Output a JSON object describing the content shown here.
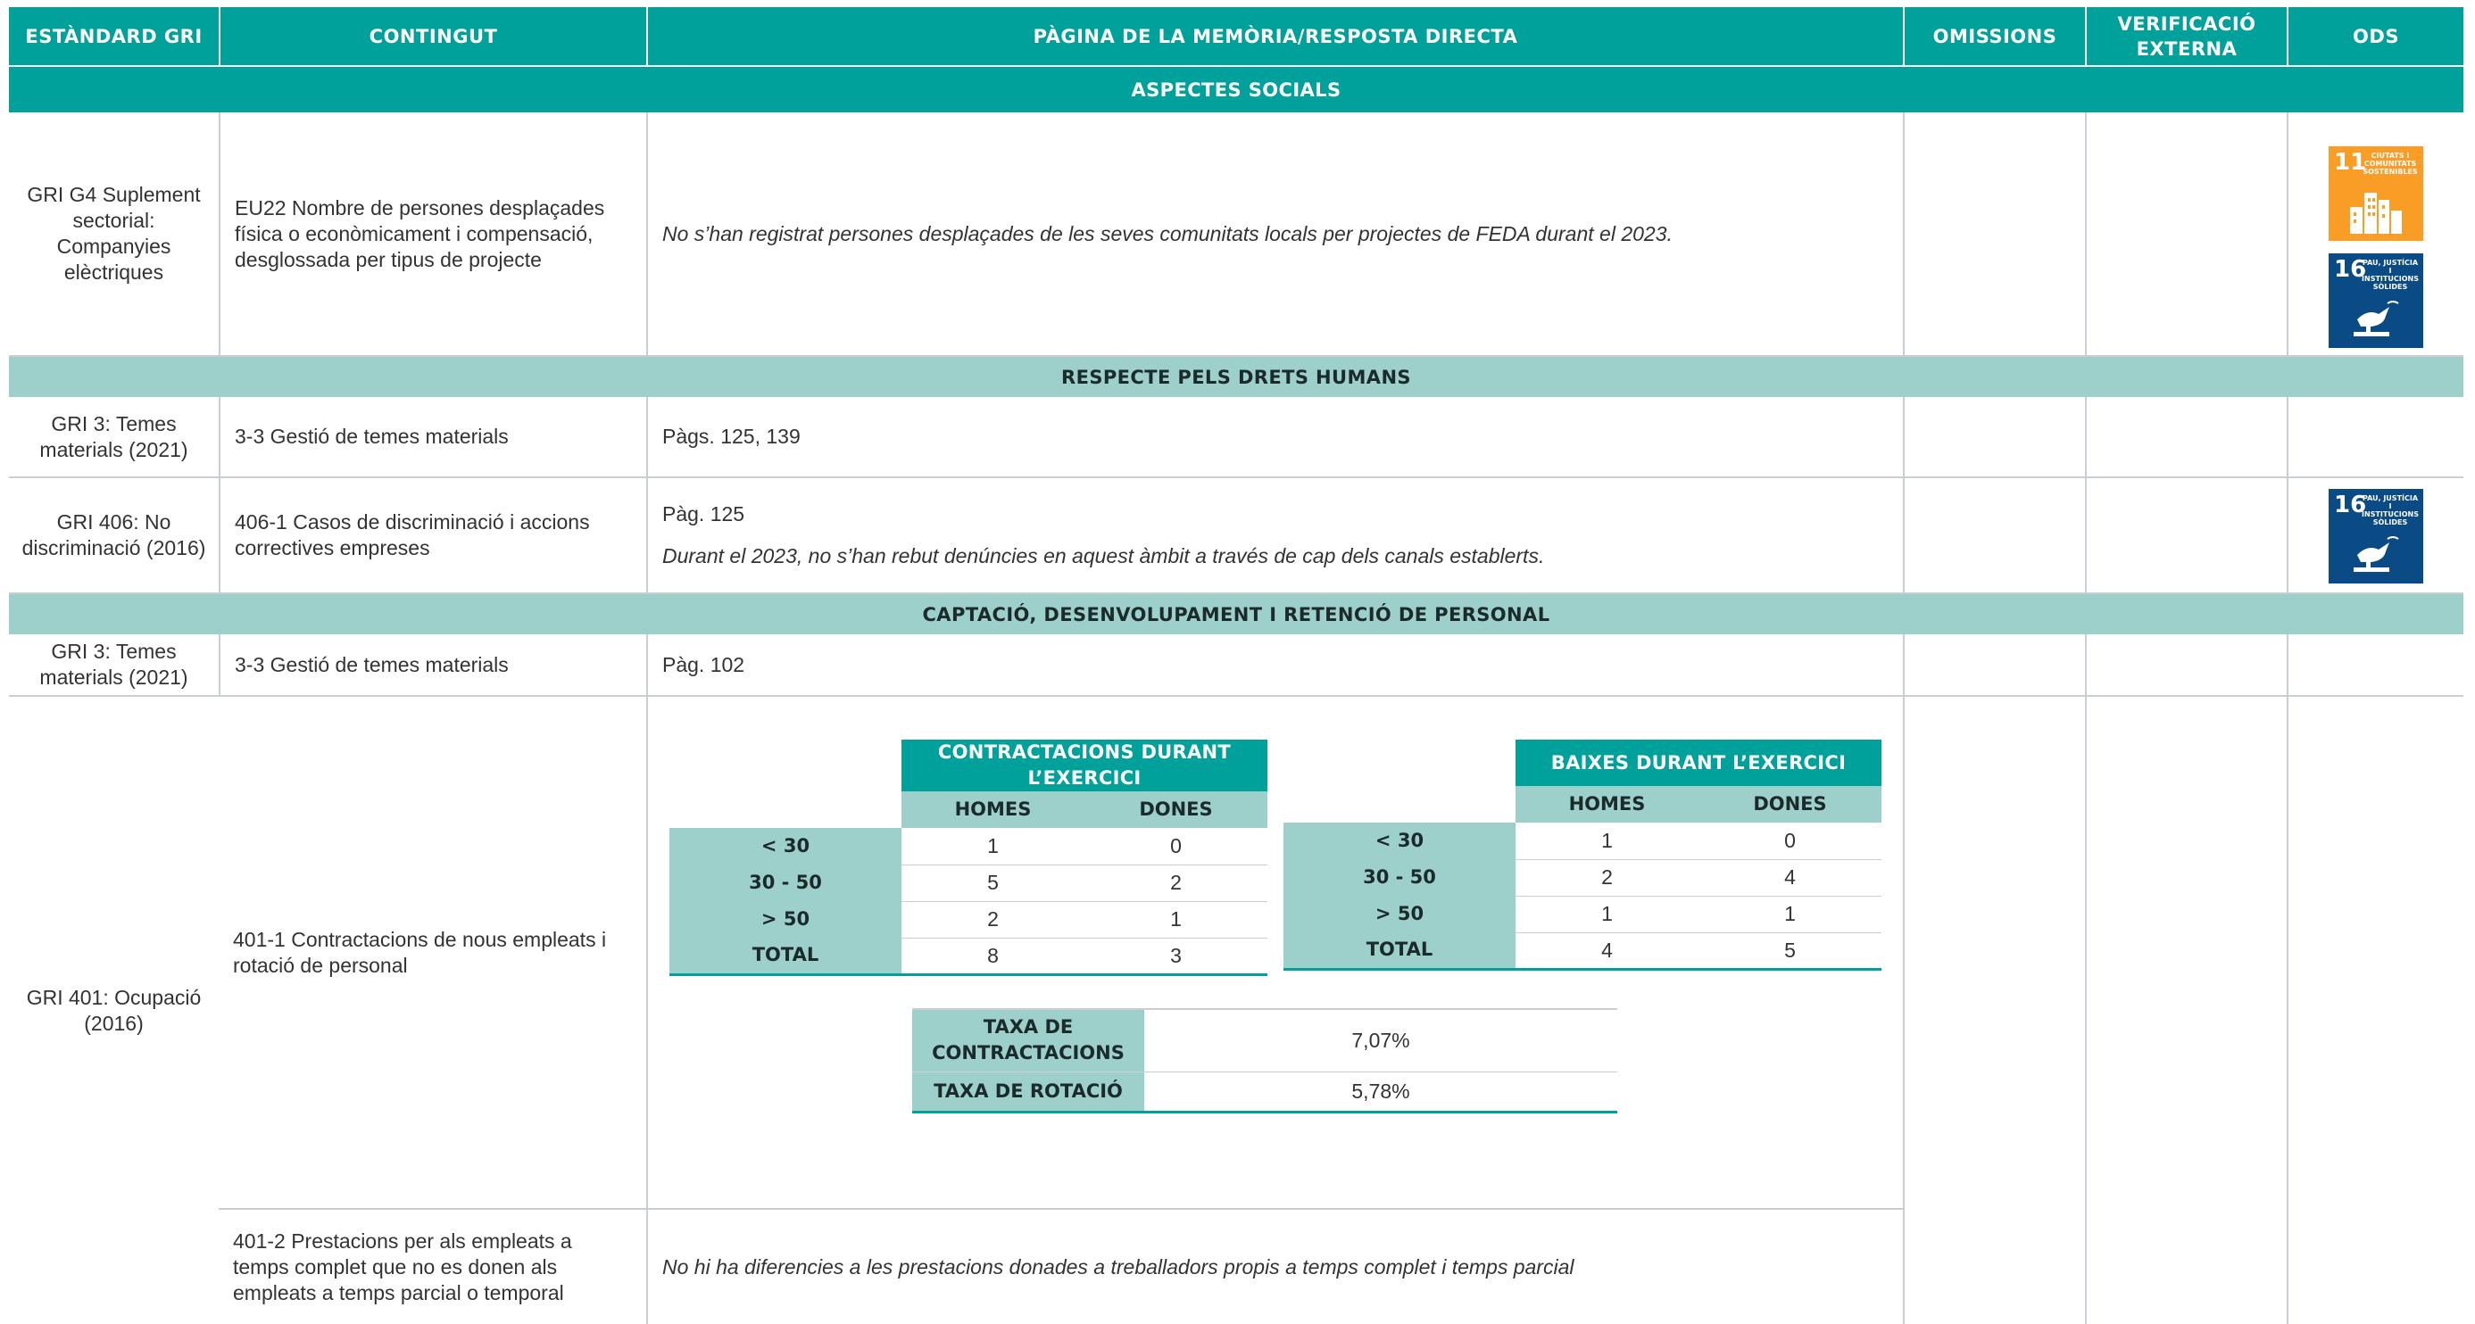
{
  "header": {
    "col1": "ESTÀNDARD GRI",
    "col2": "CONTINGUT",
    "col3": "PÀGINA DE LA MEMÒRIA/RESPOSTA DIRECTA",
    "col4": "OMISSIONS",
    "col5_line1": "VERIFICACIÓ",
    "col5_line2": "EXTERNA",
    "col6": "ODS"
  },
  "sections": {
    "s1": "ASPECTES SOCIALS",
    "s2": "RESPECTE PELS DRETS HUMANS",
    "s3": "CAPTACIÓ, DESENVOLUPAMENT I RETENCIÓ DE PERSONAL"
  },
  "sdg": {
    "sdg11": {
      "number": "11",
      "label": "CIUTATS I COMUNITATS SOSTENIBLES",
      "color": "#f99d26",
      "icon": "city-buildings-icon"
    },
    "sdg16": {
      "number": "16",
      "label": "PAU, JUSTÍCIA I INSTITUCIONS SÒLIDES",
      "color": "#0a4a85",
      "icon": "dove-on-gavel-icon"
    }
  },
  "rows": {
    "r1": {
      "standard": "GRI G4 Suplement sectorial: Companyies elèctriques",
      "content": "EU22 Nombre de persones desplaçades física o econòmicament i compensació, desglossada per tipus de projecte",
      "page": "No s’han registrat persones desplaçades de les seves comunitats locals per projectes de FEDA durant el 2023."
    },
    "r2": {
      "standard": "GRI 3: Temes materials (2021)",
      "content": "3-3 Gestió de temes materials",
      "page": "Pàgs. 125, 139"
    },
    "r3": {
      "standard": "GRI 406: No discriminació (2016)",
      "content": "406-1 Casos de discriminació i accions correctives empreses",
      "page": "Pàg. 125",
      "page_note": "Durant el 2023, no s’han rebut denúncies en aquest àmbit a través de cap dels canals establerts."
    },
    "r4": {
      "standard": "GRI 3: Temes materials (2021)",
      "content": "3-3 Gestió de temes materials",
      "page": "Pàg. 102"
    },
    "r5": {
      "standard": "GRI 401: Ocupació (2016)",
      "content": "401-1 Contractacions de nous empleats i rotació de personal"
    },
    "r6": {
      "content": "401-2 Prestacions per als empleats a temps complet que no es donen als empleats a temps parcial o temporal",
      "page": "No hi ha diferencies a les prestacions donades a treballadors propis a temps complet i temps parcial"
    }
  },
  "hires_table": {
    "title": "CONTRACTACIONS DURANT L’EXERCICI",
    "col_men": "HOMES",
    "col_women": "DONES",
    "rows": [
      {
        "label": "< 30",
        "men": "1",
        "women": "0"
      },
      {
        "label": "30 - 50",
        "men": "5",
        "women": "2"
      },
      {
        "label": "> 50",
        "men": "2",
        "women": "1"
      },
      {
        "label": "TOTAL",
        "men": "8",
        "women": "3"
      }
    ]
  },
  "leaves_table": {
    "title": "BAIXES DURANT L’EXERCICI",
    "col_men": "HOMES",
    "col_women": "DONES",
    "rows": [
      {
        "label": "< 30",
        "men": "1",
        "women": "0"
      },
      {
        "label": "30 - 50",
        "men": "2",
        "women": "4"
      },
      {
        "label": "> 50",
        "men": "1",
        "women": "1"
      },
      {
        "label": "TOTAL",
        "men": "4",
        "women": "5"
      }
    ]
  },
  "rates_table": {
    "hire_rate_label_1": "TAXA DE",
    "hire_rate_label_2": "CONTRACTACIONS",
    "hire_rate_value": "7,07%",
    "turnover_label": "TAXA DE ROTACIÓ",
    "turnover_value": "5,78%"
  }
}
